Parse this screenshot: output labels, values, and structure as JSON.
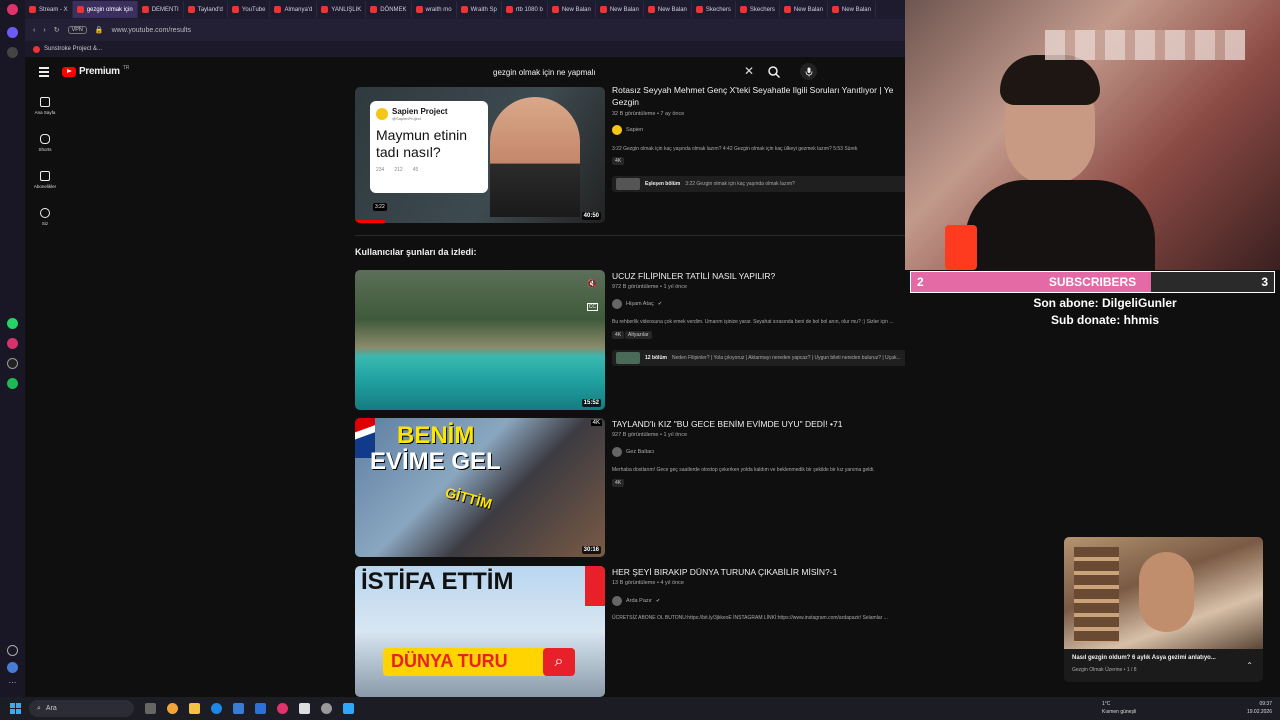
{
  "browser": {
    "tabs": [
      {
        "label": "Stream - X",
        "active": false
      },
      {
        "label": "gezgin olmak için",
        "active": true
      },
      {
        "label": "DEMENTI",
        "active": false
      },
      {
        "label": "Tayland'd",
        "active": false
      },
      {
        "label": "YouTube",
        "active": false
      },
      {
        "label": "Almanya'd",
        "active": false
      },
      {
        "label": "YANLIŞLIK",
        "active": false
      },
      {
        "label": "DÖNMEK",
        "active": false
      },
      {
        "label": "wraith mo",
        "active": false
      },
      {
        "label": "Wraith Sp",
        "active": false
      },
      {
        "label": "rtb 1080 b",
        "active": false
      },
      {
        "label": "New Balan",
        "active": false
      },
      {
        "label": "New Balan",
        "active": false
      },
      {
        "label": "New Balan",
        "active": false
      },
      {
        "label": "Skechers",
        "active": false
      },
      {
        "label": "Skechers",
        "active": false
      },
      {
        "label": "New Balan",
        "active": false
      },
      {
        "label": "New Balan",
        "active": false
      }
    ],
    "url": "www.youtube.com/results",
    "vpn_label": "VPN",
    "bookmark": "Sunstroke Project &..."
  },
  "yt": {
    "logo_text": "Premium",
    "region": "TR",
    "search_query": "gezgin olmak için ne yapmalı",
    "clear_icon": "✕",
    "nav": [
      {
        "label": "Ana Sayfa",
        "icon": "home-icon"
      },
      {
        "label": "Shorts",
        "icon": "shorts-icon"
      },
      {
        "label": "Abonelikler",
        "icon": "subscriptions-icon"
      },
      {
        "label": "Siz",
        "icon": "you-icon"
      }
    ]
  },
  "results": {
    "first": {
      "title_line1": "Rotasız Seyyah Mehmet Genç X'teki Seyahatle İlgili Soruları Yanıtlıyor | Ye",
      "title_line2": "Gezgin",
      "meta": "32 B görüntüleme • 7 ay önce",
      "channel": "Sapien",
      "desc": "3:22 Gezgin olmak için kaç yaşında olmak lazım? 4:42 Gezgin olmak için kaç ülkeyi gezmek lazım? 5:53 Sürek",
      "badge": "4K",
      "thumb_card_channel": "Sapien Project",
      "thumb_card_handle": "@SapienProject",
      "thumb_card_text": "Maymun etinin tadı nasıl?",
      "thumb_card_stats": [
        "234",
        "212",
        "45"
      ],
      "thumb_time_chip": "3:22",
      "duration": "40:50",
      "chapter_label": "Eşleşen bölüm",
      "chapter_text": "3:22 Gezgin olmak için kaç yaşında olmak lazım?"
    },
    "section_title": "Kullanıcılar şunları da izledi:",
    "items": [
      {
        "title": "UCUZ FİLİPİNLER TATİLİ NASIL YAPILIR?",
        "meta": "972 B görüntüleme • 1 yıl önce",
        "channel": "Hişam Ataç",
        "desc": "Bu rehberlik videosuna çok emek verdim. Umarım işinize yarar. Seyahat sırasında beni de bol bol anın, olur mu? :) Sizler için ...",
        "badges": [
          "4K",
          "Altyazılar"
        ],
        "duration": "15:52",
        "chapter_label": "12 bölüm",
        "chapter_text": "Neden Filipinler? | Yola çıkıyoruz | Aktarmayı nereden yapcaz? | Uygun bileti nereden buluruz? | Uçak..."
      },
      {
        "title": "TAYLAND'lı KIZ \"BU GECE BENİM EVİMDE UYU\" DEDİ! •71",
        "meta": "927 B görüntüleme • 1 yıl önce",
        "channel": "Gez Baltacı",
        "desc": "Merhaba dostlarım! Gece geç saatlerde otostop çekerken yolda kaldım ve beklenmedik bir şekilde bir kız yanıma geldi.",
        "badges": [
          "4K"
        ],
        "duration": "30:16",
        "thumb_text_1": "BENİM",
        "thumb_text_2": "EVİME GEL",
        "thumb_text_3": "GİTTİM"
      },
      {
        "title": "HER ŞEYİ BIRAKIP DÜNYA TURUNA ÇIKABİLİR MİSİN?-1",
        "meta": "13 B görüntüleme • 4 yıl önce",
        "channel": "Arda Pazır",
        "desc": "ÜCRETSİZ ABONE OL BUTONU:https://bit.ly/3jkkeoE İNSTAGRAM LİNKİ:https://www.instagram.com/ardapazir/   Selamlar ...",
        "thumb_text_1": "İSTİFA ETTİM",
        "thumb_text_2": "DÜNYA TURU"
      }
    ]
  },
  "overlay": {
    "sub_current": "2",
    "sub_goal": "3",
    "sub_label": "SUBSCRIBERS",
    "sub_progress": 0.66,
    "last_sub": "Son abone: DilgeliGunler",
    "sub_donate": "Sub donate: hhmis"
  },
  "miniplayer": {
    "title": "Nasıl gezgin oldum? 6 aylık Asya gezimi anlatıyo...",
    "sub": "Gezgin Olmak Üzerine • 1 / 8"
  },
  "taskbar": {
    "search": "Ara",
    "temp": "1°C",
    "weather": "Kısmen güneşli",
    "time": "09:37",
    "date": "19.02.2026"
  },
  "colors": {
    "yt_red": "#ff0000",
    "sub_pink": "#e46aa5",
    "page_bg": "#0f0f0f"
  }
}
